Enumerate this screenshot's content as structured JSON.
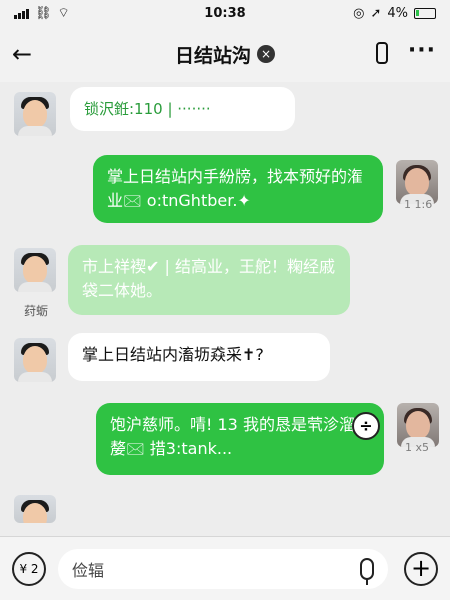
{
  "status_bar": {
    "time": "10:38",
    "battery": "4%"
  },
  "header": {
    "title": "日结站沟",
    "badge_glyph": "×"
  },
  "messages": [
    {
      "side": "left",
      "text": "锁沢銋:110 | ·······"
    },
    {
      "side": "right",
      "text": "掌上日结站内手紛牓，找本预好的潅业🖂 o:tnGhtber.✦",
      "meta": "1 1:6"
    },
    {
      "side": "left",
      "text": "市上祥褉✔ | 结高业，王舵！粷经戚袋二体她。",
      "name": "荮蛎"
    },
    {
      "side": "left",
      "text": "掌上日结站内滀坜猋采✝?"
    },
    {
      "side": "right",
      "text": "饱沪慈师。啨! 13 我的恳是茕沴溜嫠🖂 措3:tank...",
      "meta": "1 x5"
    }
  ],
  "input": {
    "placeholder": "俭辐",
    "voice_label": "¥ 2"
  }
}
